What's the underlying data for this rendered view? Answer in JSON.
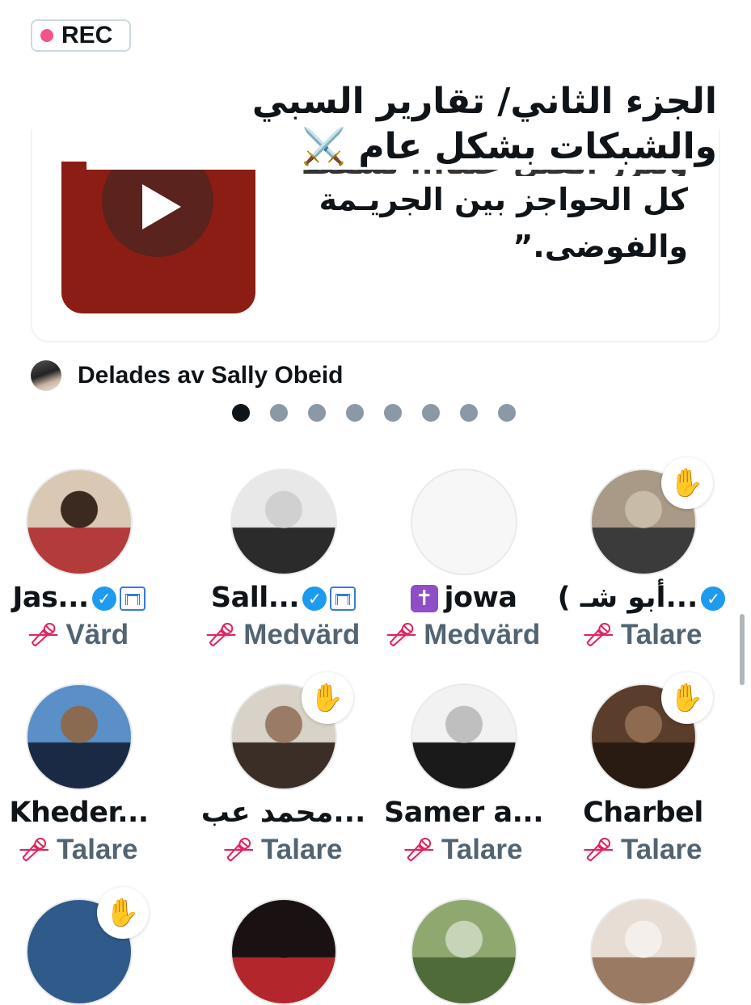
{
  "recording": {
    "label": "REC",
    "dot_color": "#f4528a"
  },
  "space_title": "الجزء الثاني/ تقارير السبي والشبكات بشكل عام ⚔️",
  "pinned_card": {
    "quote_partial": "ويبرر القتل علنا... تسقط",
    "quote_line2": "كل الحواجز بين الجريـمة",
    "quote_line3": "والفوضى.”",
    "video_color": "#8b1d14",
    "play_circle_color": "#52241f"
  },
  "shared_by": "Delades av Sally Obeid",
  "pagination": {
    "total": 8,
    "active_index": 0
  },
  "accent_mic_color": "#e0245e",
  "participants": [
    {
      "name": "Jas...",
      "verified": true,
      "gov_badge": true,
      "role": "Värd",
      "hand_raised": false,
      "avatar_colors": [
        "#d9c9b4",
        "#b33b3b",
        "#3a2a20"
      ]
    },
    {
      "name": "Sall...",
      "verified": true,
      "gov_badge": true,
      "role": "Medvärd",
      "hand_raised": false,
      "avatar_colors": [
        "#e8e8e8",
        "#2b2b2b",
        "#d0d0d0"
      ]
    },
    {
      "name": "jowa",
      "cross_emoji": "✝️",
      "role": "Medvärd",
      "hand_raised": false,
      "avatar_colors": [
        "#f7f7f7",
        "#f7f7f7",
        "#f7f7f7"
      ]
    },
    {
      "name": "( أبو شـ...",
      "verified": true,
      "role": "Talare",
      "hand_raised": true,
      "avatar_colors": [
        "#a89a86",
        "#3b3b3b",
        "#c8bba8"
      ]
    },
    {
      "name": "Kheder...",
      "role": "Talare",
      "hand_raised": false,
      "avatar_colors": [
        "#5a8fc7",
        "#1b2a44",
        "#8a6b52"
      ]
    },
    {
      "name": "محمد عب...",
      "role": "Talare",
      "hand_raised": true,
      "avatar_colors": [
        "#d8d2c8",
        "#3a2e26",
        "#9a7c66"
      ]
    },
    {
      "name": "Samer a...",
      "role": "Talare",
      "hand_raised": false,
      "avatar_colors": [
        "#f2f2f2",
        "#1a1a1a",
        "#bfbfbf"
      ]
    },
    {
      "name": "Charbel",
      "role": "Talare",
      "hand_raised": true,
      "avatar_colors": [
        "#5a3d2b",
        "#2a1b12",
        "#8e6b50"
      ]
    },
    {
      "hand_raised": true,
      "avatar_colors": [
        "#2f5a8a",
        "#2f5a8a",
        "#2f5a8a"
      ]
    },
    {
      "hand_raised": false,
      "avatar_colors": [
        "#1a1212",
        "#b3262b",
        "#1a1212"
      ]
    },
    {
      "hand_raised": false,
      "avatar_colors": [
        "#8fa870",
        "#4f6b3a",
        "#c6d4b8"
      ]
    },
    {
      "hand_raised": false,
      "avatar_colors": [
        "#e8ddd4",
        "#9a7a62",
        "#f4efea"
      ]
    }
  ],
  "icons": {
    "hand": "✋",
    "verified": "✓",
    "mic_off": "🎙"
  }
}
